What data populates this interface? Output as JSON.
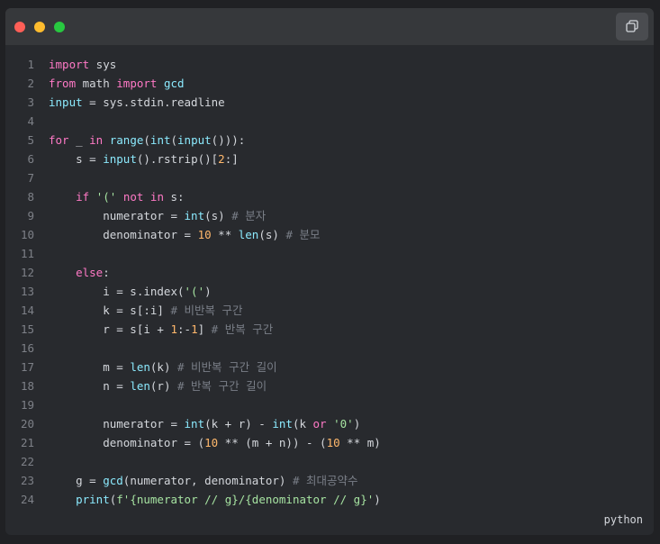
{
  "window": {
    "controls": [
      "close",
      "minimize",
      "maximize"
    ],
    "copy_icon": "copy-icon"
  },
  "code": {
    "language": "python",
    "lines": [
      "import sys",
      "from math import gcd",
      "input = sys.stdin.readline",
      "",
      "for _ in range(int(input())):",
      "    s = input().rstrip()[2:]",
      "",
      "    if '(' not in s:",
      "        numerator = int(s) # 분자",
      "        denominator = 10 ** len(s) # 분모",
      "",
      "    else:",
      "        i = s.index('(')",
      "        k = s[:i] # 비반복 구간",
      "        r = s[i + 1:-1] # 반복 구간",
      "",
      "        m = len(k) # 비반복 구간 길이",
      "        n = len(r) # 반복 구간 길이",
      "",
      "        numerator = int(k + r) - int(k or '0')",
      "        denominator = (10 ** (m + n)) - (10 ** m)",
      "",
      "    g = gcd(numerator, denominator) # 최대공약수",
      "    print(f'{numerator // g}/{denominator // g}')"
    ]
  },
  "colors": {
    "keyword": "#ff79c6",
    "builtin": "#8be9fd",
    "number": "#ffb86c",
    "string": "#a6e3a1",
    "comment": "#7a7f88",
    "text": "#d4d7dc"
  }
}
